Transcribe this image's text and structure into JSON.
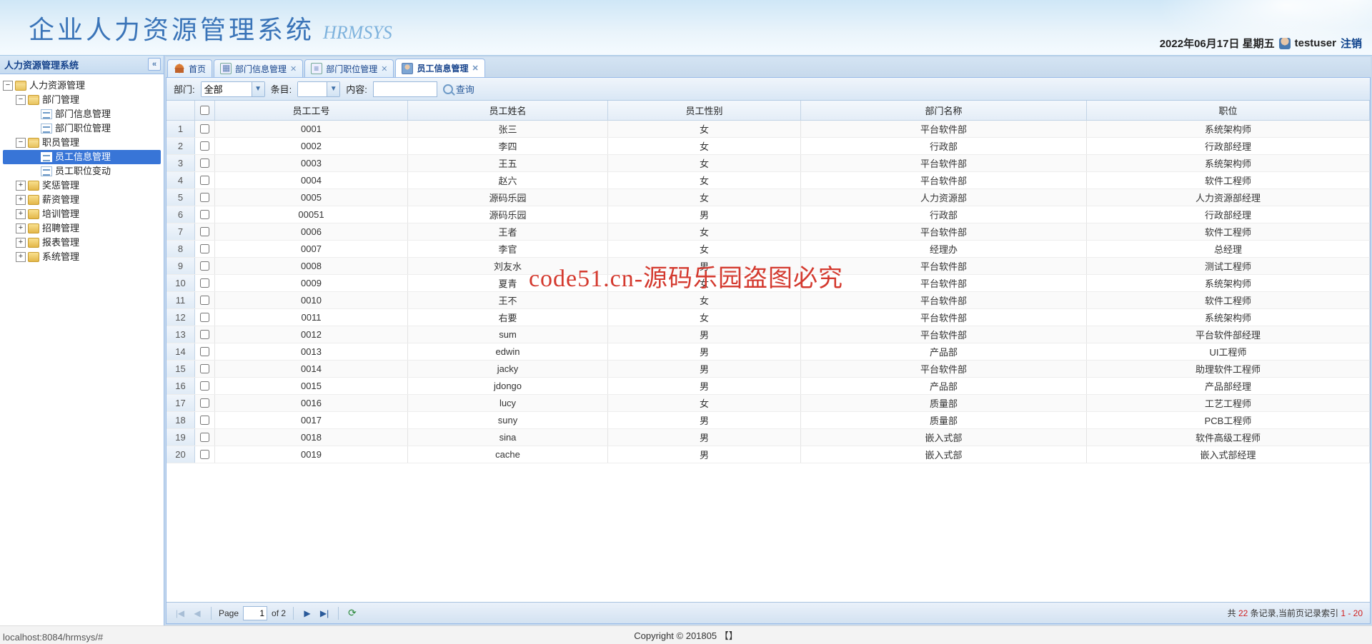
{
  "header": {
    "title": "企业人力资源管理系统",
    "subtitle": "HRMSYS",
    "date": "2022年06月17日 星期五",
    "user": "testuser",
    "logout": "注销"
  },
  "sidebar": {
    "title": "人力资源管理系统",
    "nodes": [
      {
        "label": "人力资源管理",
        "indent": 0,
        "toggle": "−",
        "icon": "folder-open"
      },
      {
        "label": "部门管理",
        "indent": 1,
        "toggle": "−",
        "icon": "folder-open"
      },
      {
        "label": "部门信息管理",
        "indent": 2,
        "toggle": "",
        "icon": "leaf"
      },
      {
        "label": "部门职位管理",
        "indent": 2,
        "toggle": "",
        "icon": "leaf"
      },
      {
        "label": "职员管理",
        "indent": 1,
        "toggle": "−",
        "icon": "folder-open"
      },
      {
        "label": "员工信息管理",
        "indent": 2,
        "toggle": "",
        "icon": "leaf",
        "selected": true
      },
      {
        "label": "员工职位变动",
        "indent": 2,
        "toggle": "",
        "icon": "leaf"
      },
      {
        "label": "奖惩管理",
        "indent": 1,
        "toggle": "+",
        "icon": "folder"
      },
      {
        "label": "薪资管理",
        "indent": 1,
        "toggle": "+",
        "icon": "folder"
      },
      {
        "label": "培训管理",
        "indent": 1,
        "toggle": "+",
        "icon": "folder"
      },
      {
        "label": "招聘管理",
        "indent": 1,
        "toggle": "+",
        "icon": "folder"
      },
      {
        "label": "报表管理",
        "indent": 1,
        "toggle": "+",
        "icon": "folder"
      },
      {
        "label": "系统管理",
        "indent": 1,
        "toggle": "+",
        "icon": "folder"
      }
    ]
  },
  "tabs": [
    {
      "label": "首页",
      "icon": "home",
      "closable": false,
      "active": false
    },
    {
      "label": "部门信息管理",
      "icon": "dept",
      "closable": true,
      "active": false
    },
    {
      "label": "部门职位管理",
      "icon": "pos",
      "closable": true,
      "active": false
    },
    {
      "label": "员工信息管理",
      "icon": "emp",
      "closable": true,
      "active": true
    }
  ],
  "toolbar": {
    "dept_label": "部门:",
    "dept_value": "全部",
    "field_label": "条目:",
    "field_value": "",
    "content_label": "内容:",
    "content_value": "",
    "search": "查询"
  },
  "grid": {
    "columns": [
      "员工工号",
      "员工姓名",
      "员工性别",
      "部门名称",
      "职位"
    ],
    "rows": [
      [
        "0001",
        "张三",
        "女",
        "平台软件部",
        "系统架构师"
      ],
      [
        "0002",
        "李四",
        "女",
        "行政部",
        "行政部经理"
      ],
      [
        "0003",
        "王五",
        "女",
        "平台软件部",
        "系统架构师"
      ],
      [
        "0004",
        "赵六",
        "女",
        "平台软件部",
        "软件工程师"
      ],
      [
        "0005",
        "源码乐园",
        "女",
        "人力资源部",
        "人力资源部经理"
      ],
      [
        "00051",
        "源码乐园",
        "男",
        "行政部",
        "行政部经理"
      ],
      [
        "0006",
        "王者",
        "女",
        "平台软件部",
        "软件工程师"
      ],
      [
        "0007",
        "李官",
        "女",
        "经理办",
        "总经理"
      ],
      [
        "0008",
        "刘友水",
        "男",
        "平台软件部",
        "测试工程师"
      ],
      [
        "0009",
        "夏青",
        "女",
        "平台软件部",
        "系统架构师"
      ],
      [
        "0010",
        "王不",
        "女",
        "平台软件部",
        "软件工程师"
      ],
      [
        "0011",
        "右要",
        "女",
        "平台软件部",
        "系统架构师"
      ],
      [
        "0012",
        "sum",
        "男",
        "平台软件部",
        "平台软件部经理"
      ],
      [
        "0013",
        "edwin",
        "男",
        "产品部",
        "UI工程师"
      ],
      [
        "0014",
        "jacky",
        "男",
        "平台软件部",
        "助理软件工程师"
      ],
      [
        "0015",
        "jdongo",
        "男",
        "产品部",
        "产品部经理"
      ],
      [
        "0016",
        "lucy",
        "女",
        "质量部",
        "工艺工程师"
      ],
      [
        "0017",
        "suny",
        "男",
        "质量部",
        "PCB工程师"
      ],
      [
        "0018",
        "sina",
        "男",
        "嵌入式部",
        "软件高级工程师"
      ],
      [
        "0019",
        "cache",
        "男",
        "嵌入式部",
        "嵌入式部经理"
      ]
    ]
  },
  "pager": {
    "page_label": "Page",
    "page": "1",
    "of_label": "of 2",
    "summary_prefix": "共 ",
    "total": "22",
    "summary_mid": " 条记录,当前页记录索引 ",
    "range": "1 - 20"
  },
  "footer": {
    "copyright": "Copyright © 201805 【】",
    "status": "localhost:8084/hrmsys/#"
  },
  "watermark": "code51.cn-源码乐园盗图必究"
}
